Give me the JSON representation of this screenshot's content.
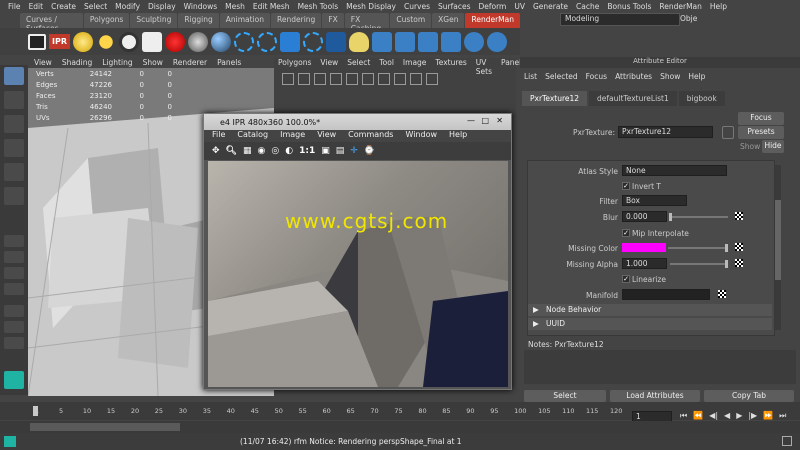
{
  "menubar": [
    "File",
    "Edit",
    "Create",
    "Select",
    "Modify",
    "Display",
    "Windows",
    "Mesh",
    "Edit Mesh",
    "Mesh Tools",
    "Mesh Display",
    "Curves",
    "Surfaces",
    "Deform",
    "UV",
    "Generate",
    "Cache",
    "Bonus Tools",
    "RenderMan",
    "Help"
  ],
  "shelf_tabs": [
    "Curves / Surfaces",
    "Polygons",
    "Sculpting",
    "Rigging",
    "Animation",
    "Rendering",
    "FX",
    "FX Caching",
    "Custom",
    "XGen",
    "RenderMan"
  ],
  "workspace": {
    "mode": "Modeling",
    "objects_label": "Obje"
  },
  "toolbar": {
    "ipr_label": "IPR"
  },
  "viewport_menu": [
    "View",
    "Shading",
    "Lighting",
    "Show",
    "Renderer",
    "Panels"
  ],
  "hud": {
    "rows": [
      {
        "label": "Verts",
        "a": "24142",
        "b": "0",
        "c": "0"
      },
      {
        "label": "Edges",
        "a": "47226",
        "b": "0",
        "c": "0"
      },
      {
        "label": "Faces",
        "a": "23120",
        "b": "0",
        "c": "0"
      },
      {
        "label": "Tris",
        "a": "46240",
        "b": "0",
        "c": "0"
      },
      {
        "label": "UVs",
        "a": "26296",
        "b": "0",
        "c": "0"
      }
    ]
  },
  "uv_menu": [
    "Polygons",
    "View",
    "Select",
    "Tool",
    "Image",
    "Textures",
    "UV Sets",
    "Panels"
  ],
  "ipr": {
    "title": "e4 IPR 480x360 100.0%*",
    "menu": [
      "File",
      "Catalog",
      "Image",
      "View",
      "Commands",
      "Window",
      "Help"
    ],
    "ratio": "1:1",
    "watermark": "www.cgtsj.com"
  },
  "attr": {
    "title": "Attribute Editor",
    "menu": [
      "List",
      "Selected",
      "Focus",
      "Attributes",
      "Show",
      "Help"
    ],
    "tabs": [
      "PxrTexture12",
      "defaultTextureList1",
      "bigbook"
    ],
    "node_label": "PxrTexture:",
    "node_name": "PxrTexture12",
    "focus": "Focus",
    "presets": "Presets",
    "show": "Show",
    "hide": "Hide",
    "atlas_style_label": "Atlas Style",
    "atlas_style": "None",
    "invert_t": "Invert T",
    "filter_label": "Filter",
    "filter": "Box",
    "blur_label": "Blur",
    "blur": "0.000",
    "mip_interpolate": "Mip Interpolate",
    "missing_color_label": "Missing Color",
    "missing_color": "#ff00ff",
    "missing_alpha_label": "Missing Alpha",
    "missing_alpha": "1.000",
    "linearize": "Linearize",
    "manifold_label": "Manifold",
    "sections": [
      "Node Behavior",
      "UUID"
    ],
    "notes_label": "Notes:  PxrTexture12",
    "buttons": [
      "Select",
      "Load Attributes",
      "Copy Tab"
    ]
  },
  "timeline": {
    "ticks": [
      "1",
      "5",
      "10",
      "15",
      "20",
      "25",
      "30",
      "35",
      "40",
      "45",
      "50",
      "55",
      "60",
      "65",
      "70",
      "75",
      "80",
      "85",
      "90",
      "95",
      "100",
      "105",
      "110",
      "115",
      "120"
    ],
    "current_frame": "1"
  },
  "status": {
    "message": "(11/07 16:42) rfm Notice: Rendering perspShape_Final at 1"
  }
}
